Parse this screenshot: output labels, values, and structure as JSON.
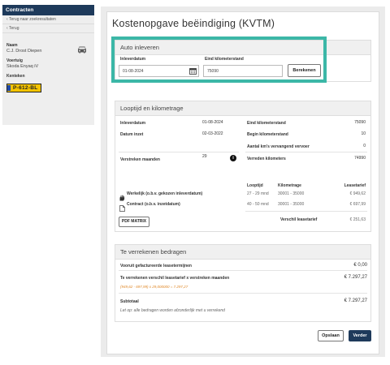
{
  "sidebar": {
    "header": "Contracten",
    "links": [
      "‹ Terug naar zoekresultaten",
      "‹ Terug"
    ],
    "name_label": "Naam",
    "name_value": "C.J. Drost Diepen",
    "vehicle_label": "Voertuig",
    "vehicle_value": "Skoda Enyaq iV",
    "plate_label": "Kenteken",
    "plate_value": "P-612-BL"
  },
  "page": {
    "title": "Kostenopgave beëindiging (KVTM)"
  },
  "auto_inleveren": {
    "header": "Auto inleveren",
    "date_label": "Inleverdatum",
    "date_value": "01-08-2024",
    "km_label": "Eind kilometerstand",
    "km_value": "75090",
    "calc_button": "Berekenen"
  },
  "looptijd": {
    "header": "Looptijd en kilometrage",
    "left": [
      {
        "label": "Inleverdatum",
        "value": "01-08-2024"
      },
      {
        "label": "Datum inzet",
        "value": "02-03-2022"
      },
      {
        "label": "Verstreken maanden",
        "value": "29"
      }
    ],
    "right": [
      {
        "label": "Eind kilometerstand",
        "value": "75090"
      },
      {
        "label": "Begin kilometerstand",
        "value": "10"
      },
      {
        "label": "Aantal km's vervangend vervoer",
        "value": "0"
      },
      {
        "label": "Verreden kilometers",
        "value": "74990"
      }
    ],
    "table": {
      "headers": [
        "Looptijd",
        "Kilometrage",
        "Leasetarief"
      ],
      "rows": [
        {
          "label": "Werkelijk (o.b.v. gekozen inleverdatum)",
          "looptijd": "27 - 29 mnd",
          "km": "30001 - 35000",
          "tarief": "€ 949,62"
        },
        {
          "label": "Contract (o.b.v. inzetdatum)",
          "looptijd": "40 - 50 mnd",
          "km": "30001 - 35000",
          "tarief": "€ 697,99"
        }
      ],
      "verschil_label": "Verschil leasetarief",
      "verschil_value": "€ 251,63"
    },
    "pdf_button": "PDF MATRIX"
  },
  "verrekenen": {
    "header": "Te verrekenen bedragen",
    "row1_label": "Vooruit gefactureerde leasetermijnen",
    "row1_value": "€ 0,00",
    "row2_label": "Te verrekenen verschil leasetarief x verstreken maanden",
    "row2_value": "€ 7.297,27",
    "row2_formula": "(949,62 - 697,99) x 29,000000 = 7.297,27",
    "subtotal_label": "Subtotaal",
    "subtotal_value": "€ 7.297,27",
    "note": "Let op: alle bedragen worden afzonderlijk met u verrekend"
  },
  "footer": {
    "cancel": "Opslaan",
    "next": "Verder"
  },
  "colors": {
    "navy": "#1e3a5b",
    "highlight": "#3cb7a7",
    "plate": "#f5c400",
    "formula": "#e08a2b"
  }
}
